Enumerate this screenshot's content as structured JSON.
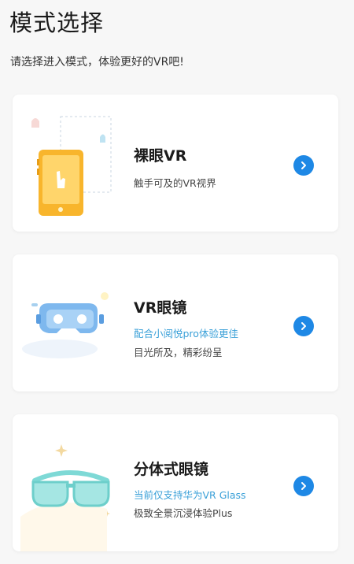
{
  "header": {
    "title": "模式选择",
    "subtitle": "请选择进入模式，体验更好的VR吧!"
  },
  "modes": [
    {
      "title": "裸眼VR",
      "description": "触手可及的VR视界",
      "icon": "phone-icon"
    },
    {
      "title": "VR眼镜",
      "tag": "配合小阅悦pro体验更佳",
      "description": "目光所及，精彩纷呈",
      "icon": "vr-headset-icon"
    },
    {
      "title": "分体式眼镜",
      "tag": "当前仅支持华为VR Glass",
      "description": "极致全景沉浸体验Plus",
      "icon": "vr-glasses-icon"
    }
  ],
  "colors": {
    "accent": "#1e88e5",
    "tag": "#3aa0d8",
    "phone": "#f8b52c",
    "headset": "#7eb8ee",
    "glasses": "#7ed9d6"
  }
}
